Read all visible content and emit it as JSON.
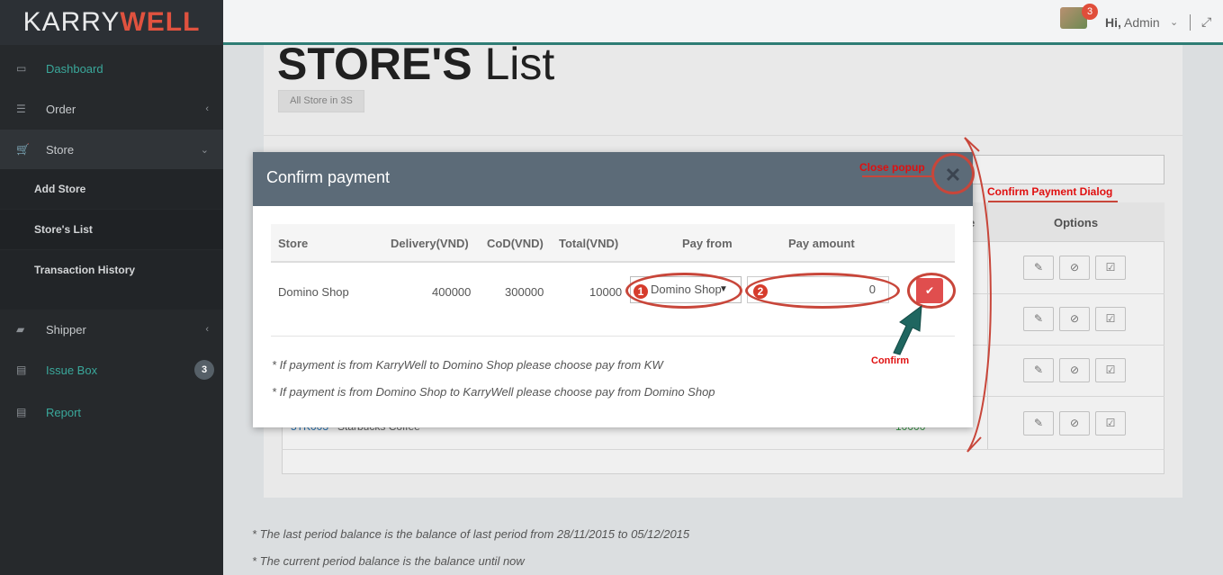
{
  "logo": {
    "part1": "KARRY",
    "part2": "WELL"
  },
  "sidebar": {
    "items": [
      {
        "label": "Dashboard"
      },
      {
        "label": "Order"
      },
      {
        "label": "Store"
      },
      {
        "label": "Shipper"
      },
      {
        "label": "Issue Box",
        "badge": "3"
      },
      {
        "label": "Report"
      }
    ],
    "sub_items": [
      {
        "label": "Add Store"
      },
      {
        "label": "Store's List"
      },
      {
        "label": "Transaction History"
      }
    ]
  },
  "topbar": {
    "greeting_prefix": "Hi,",
    "user": "Admin",
    "notif_count": "3"
  },
  "page": {
    "title_bold": "STORE'S",
    "title_light": "List",
    "sub_button": "All Store in 3S",
    "table_head_fragment": "e",
    "table_head_options": "Options",
    "row4_fragment_1": "5TK003",
    "row4_fragment_2": "Starbucks Coffee",
    "row4_fragment_3": "10000",
    "footnote1": "* The last period balance is the balance of last period from 28/11/2015 to 05/12/2015",
    "footnote2": "* The current period balance is the balance until now"
  },
  "modal": {
    "title": "Confirm payment",
    "close_symbol": "✕",
    "headers": {
      "store": "Store",
      "delivery": "Delivery(VND)",
      "cod": "CoD(VND)",
      "total": "Total(VND)",
      "pay_from": "Pay from",
      "pay_amount": "Pay amount"
    },
    "row": {
      "store": "Domino Shop",
      "delivery": "400000",
      "cod": "300000",
      "total": "10000",
      "pay_from_value": "Domino Shop",
      "pay_amount_value": "0"
    },
    "notes": [
      "* If payment is from KarryWell to Domino Shop please choose pay from KW",
      "* If payment is from Domino Shop to KarryWell please choose pay from Domino Shop"
    ]
  },
  "annotations": {
    "close_popup": "Close popup",
    "confirm_payment_dialog": "Confirm Payment Dialog",
    "confirm": "Confirm",
    "num1": "1",
    "num2": "2"
  },
  "colors": {
    "accent": "#2e7d75",
    "brand_red": "#e0523f",
    "annotation_red": "#c8463a",
    "modal_header": "#5c6b78"
  }
}
